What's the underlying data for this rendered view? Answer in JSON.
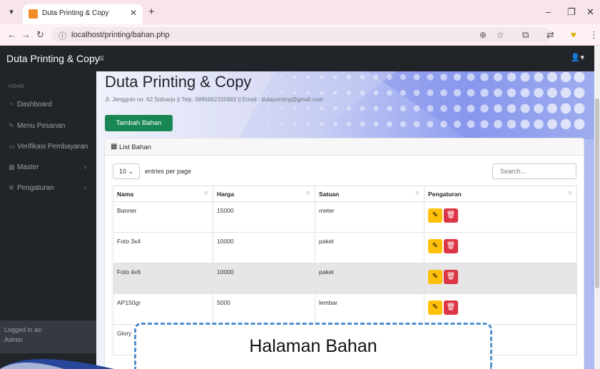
{
  "browser": {
    "tab_title": "Duta Printing & Copy",
    "url": "localhost/printing/bahan.php"
  },
  "app": {
    "brand": "Duta Printing & Copy",
    "toggle_icon": "hamburger-icon",
    "user_icon": "user-icon"
  },
  "sidebar": {
    "heading": "HOME",
    "items": [
      {
        "label": "Dashboard",
        "icon": "dashboard-icon",
        "submenu": false
      },
      {
        "label": "Menu Pesanan",
        "icon": "pen-icon",
        "submenu": false
      },
      {
        "label": "Verifikasi Pembayaran",
        "icon": "card-icon",
        "submenu": false
      },
      {
        "label": "Master",
        "icon": "table-icon",
        "submenu": true
      },
      {
        "label": "Pengaturan",
        "icon": "gear-icon",
        "submenu": true
      }
    ],
    "footer_label": "Logged in as:",
    "footer_user": "Admin"
  },
  "main": {
    "title": "Duta Printing & Copy",
    "subtitle": "Jl. Jenggolo no. 62 Sidoarjo || Telp. 0895662335883 || Email : dutaprinting@gmail.com",
    "add_button": "Tambah Bahan",
    "card_title": "List Bahan",
    "entries_value": "10",
    "entries_label": "entries per page",
    "search_placeholder": "Search...",
    "columns": [
      "Nama",
      "Harga",
      "Satuan",
      "Pengaturan"
    ],
    "rows": [
      {
        "nama": "Banner",
        "harga": "15000",
        "satuan": "meter"
      },
      {
        "nama": "Foto 3x4",
        "harga": "10000",
        "satuan": "paket"
      },
      {
        "nama": "Foto 4x6",
        "harga": "10000",
        "satuan": "paket"
      },
      {
        "nama": "AP150gr",
        "harga": "5000",
        "satuan": "lembar"
      },
      {
        "nama": "Glory",
        "harga": "",
        "satuan": ""
      }
    ]
  },
  "overlay": {
    "caption": "Halaman Bahan"
  },
  "colors": {
    "navbar": "#212529",
    "add_button": "#198754",
    "edit_button": "#ffc107",
    "delete_button": "#dc3545",
    "caption_border": "#4e8fcf"
  }
}
